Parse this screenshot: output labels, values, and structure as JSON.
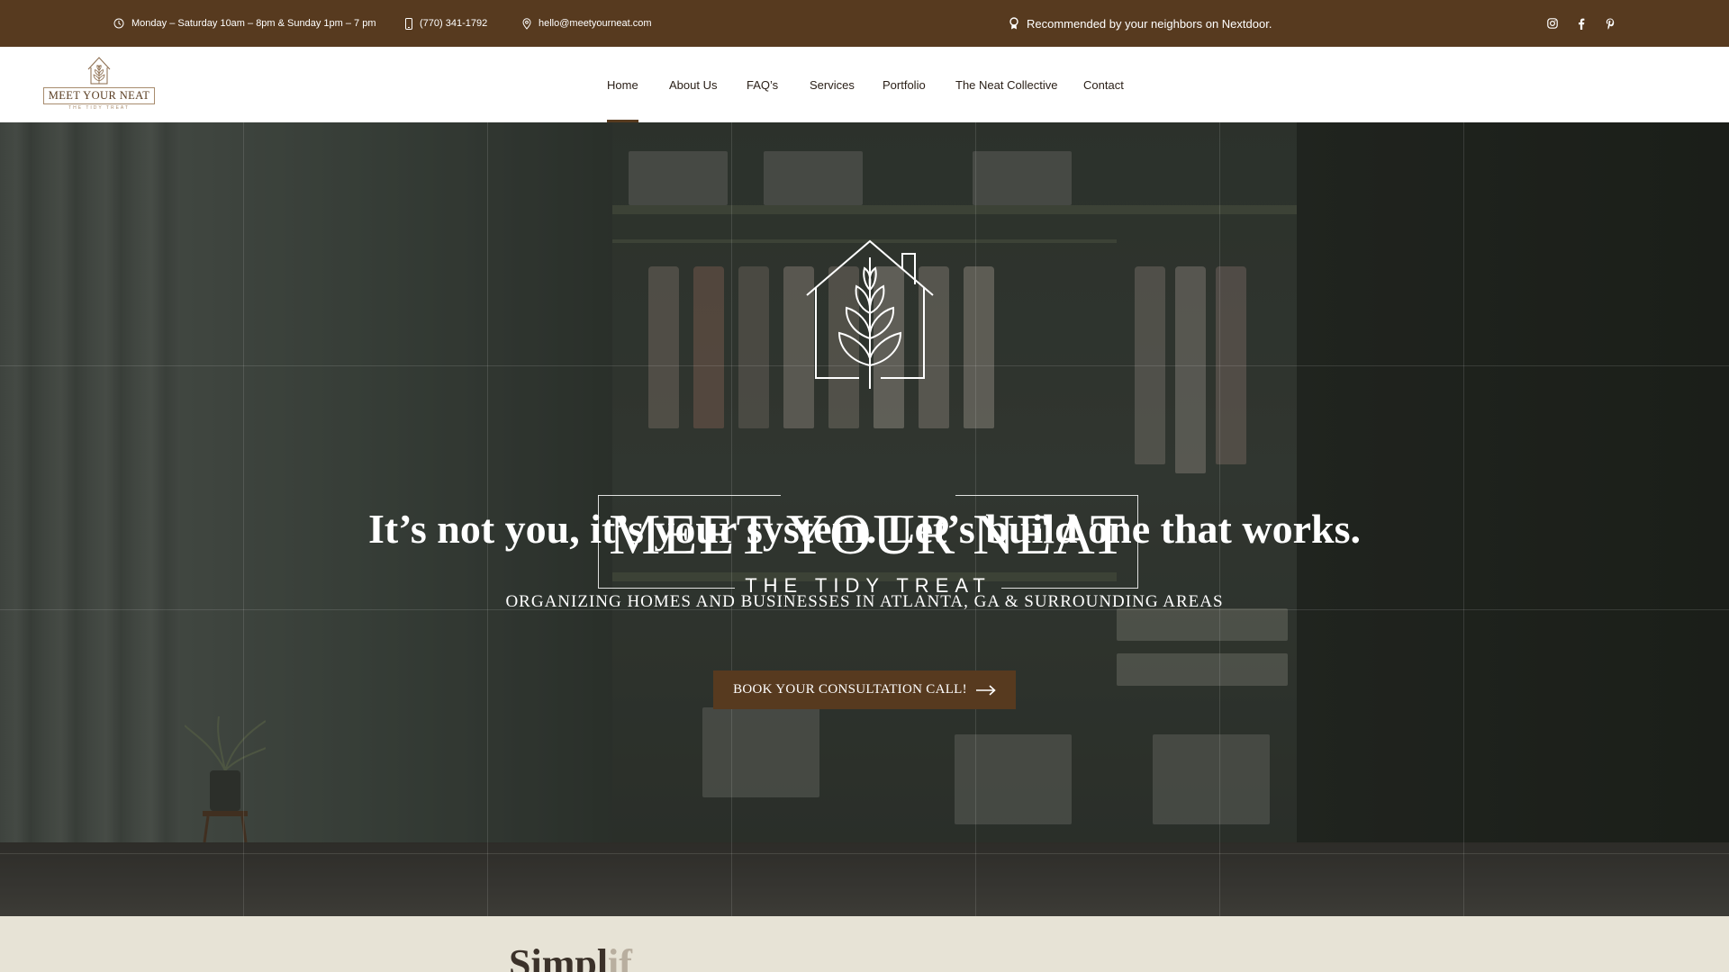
{
  "topbar": {
    "hours": "Monday – Saturday 10am – 8pm & Sunday 1pm – 7 pm",
    "phone": "(770) 341-1792",
    "email": "hello@meetyourneat.com",
    "nextdoor": "Recommended by your neighbors on Nextdoor.",
    "social": [
      "instagram-icon",
      "facebook-icon",
      "pinterest-icon"
    ]
  },
  "header": {
    "logo": {
      "name": "MEET YOUR NEAT",
      "tagline": "THE TIDY TREAT"
    },
    "nav": [
      {
        "label": "Home",
        "active": true
      },
      {
        "label": "About Us"
      },
      {
        "label": "FAQ’s"
      },
      {
        "label": "Services"
      },
      {
        "label": "Portfolio"
      },
      {
        "label": "The Neat Collective"
      },
      {
        "label": "Contact"
      }
    ]
  },
  "hero": {
    "logo_name": "MEET YOUR NEAT",
    "logo_tagline": "THE TIDY TREAT",
    "heading": "It’s not you, it’s your system. Let’s build one that works.",
    "subheading": "ORGANIZING HOMES AND BUSINESSES IN ATLANTA, GA & SURROUNDING AREAS",
    "cta_label": "BOOK YOUR CONSULTATION CALL!"
  },
  "next_section": {
    "heading_visible": "Simpl",
    "heading_faded": "if"
  },
  "colors": {
    "brand_brown": "#573a1f",
    "section_bg": "#e7e3d6",
    "white": "#ffffff"
  }
}
